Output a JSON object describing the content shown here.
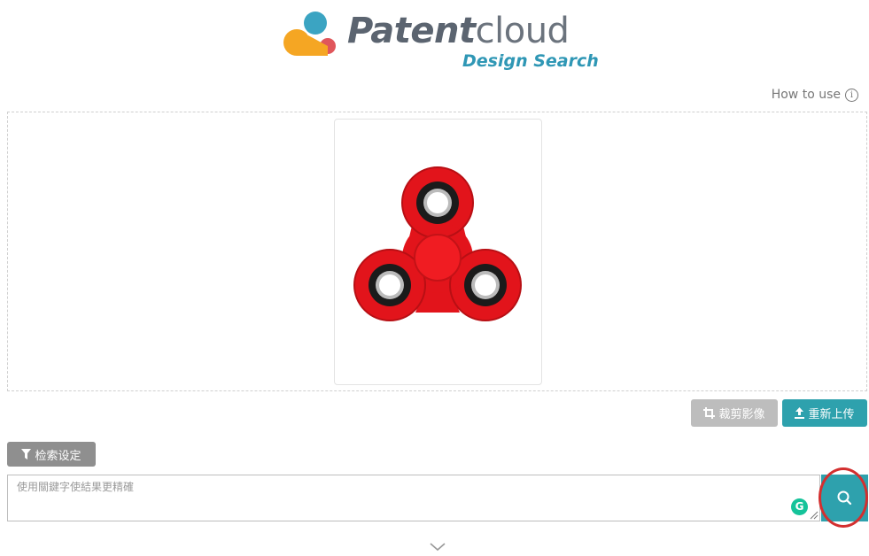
{
  "brand": {
    "name_bold": "Patent",
    "name_light": "cloud",
    "subtitle": "Design Search",
    "colors": {
      "orange": "#f5a623",
      "teal": "#3ba4c2",
      "red": "#e0565b",
      "subtitle": "#2f97b5"
    }
  },
  "help": {
    "label": "How to use",
    "icon": "info-circle-icon"
  },
  "upload": {
    "image_alt": "fidget spinner",
    "crop_label": "裁剪影像",
    "crop_icon": "crop-icon",
    "reupload_label": "重新上传",
    "reupload_icon": "upload-icon"
  },
  "search": {
    "settings_label": "检索设定",
    "settings_icon": "filter-icon",
    "placeholder": "使用關鍵字使結果更精確",
    "grammarly_letter": "G",
    "button_icon": "search-icon",
    "accent": "#2ea1ad"
  },
  "footer": {
    "expand_icon": "chevron-down-icon"
  }
}
